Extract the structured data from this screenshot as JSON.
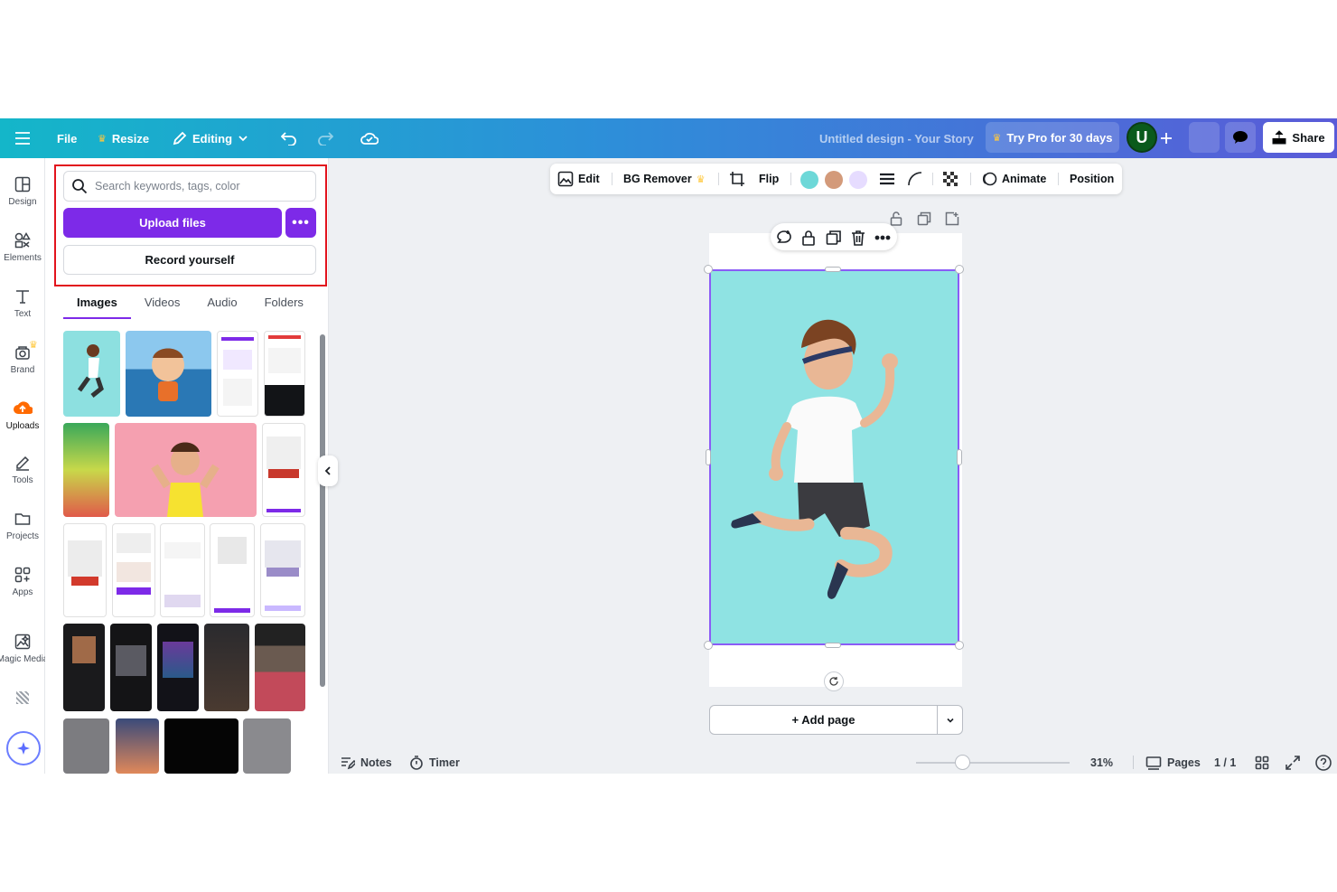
{
  "topbar": {
    "file_label": "File",
    "resize_label": "Resize",
    "editing_label": "Editing",
    "doc_title": "Untitled design - Your Story",
    "pro_label": "Try Pro for 30 days",
    "avatar_initial": "U",
    "share_label": "Share"
  },
  "rail": {
    "items": [
      {
        "label": "Design",
        "icon": "design-icon"
      },
      {
        "label": "Elements",
        "icon": "elements-icon"
      },
      {
        "label": "Text",
        "icon": "text-icon"
      },
      {
        "label": "Brand",
        "icon": "brand-icon"
      },
      {
        "label": "Uploads",
        "icon": "uploads-icon"
      },
      {
        "label": "Tools",
        "icon": "tools-icon"
      },
      {
        "label": "Projects",
        "icon": "projects-icon"
      },
      {
        "label": "Apps",
        "icon": "apps-icon"
      },
      {
        "label": "Magic Media",
        "icon": "magic-media-icon"
      }
    ]
  },
  "uploads_panel": {
    "search_placeholder": "Search keywords, tags, color",
    "upload_label": "Upload files",
    "more_label": "•••",
    "record_label": "Record yourself",
    "tabs": [
      "Images",
      "Videos",
      "Audio",
      "Folders"
    ],
    "active_tab": "Images"
  },
  "context_toolbar": {
    "edit_label": "Edit",
    "bg_remover_label": "BG Remover",
    "flip_label": "Flip",
    "animate_label": "Animate",
    "position_label": "Position",
    "swatches": [
      "#6dd8d8",
      "#d39a7a",
      "#e6dcff"
    ]
  },
  "canvas": {
    "add_page_label": "+ Add page",
    "image_background": "#8fe3e3"
  },
  "bottombar": {
    "notes_label": "Notes",
    "timer_label": "Timer",
    "zoom_label": "31%",
    "pages_label": "Pages",
    "page_count": "1 / 1"
  },
  "colors": {
    "accent": "#7d2ae8",
    "highlight_box": "#e2131d",
    "selection": "#8b5cf6"
  }
}
